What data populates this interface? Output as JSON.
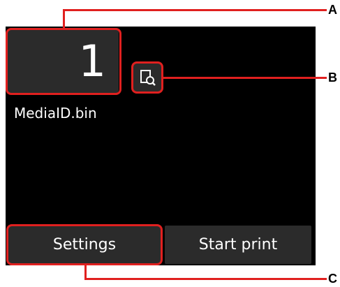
{
  "copies": {
    "value": "1"
  },
  "preview": {
    "icon": "preview-magnify-icon"
  },
  "file": {
    "name": "MediaID.bin"
  },
  "buttons": {
    "settings_label": "Settings",
    "start_label": "Start print"
  },
  "callouts": {
    "a": "A",
    "b": "B",
    "c": "C",
    "color": "#e0201f"
  }
}
